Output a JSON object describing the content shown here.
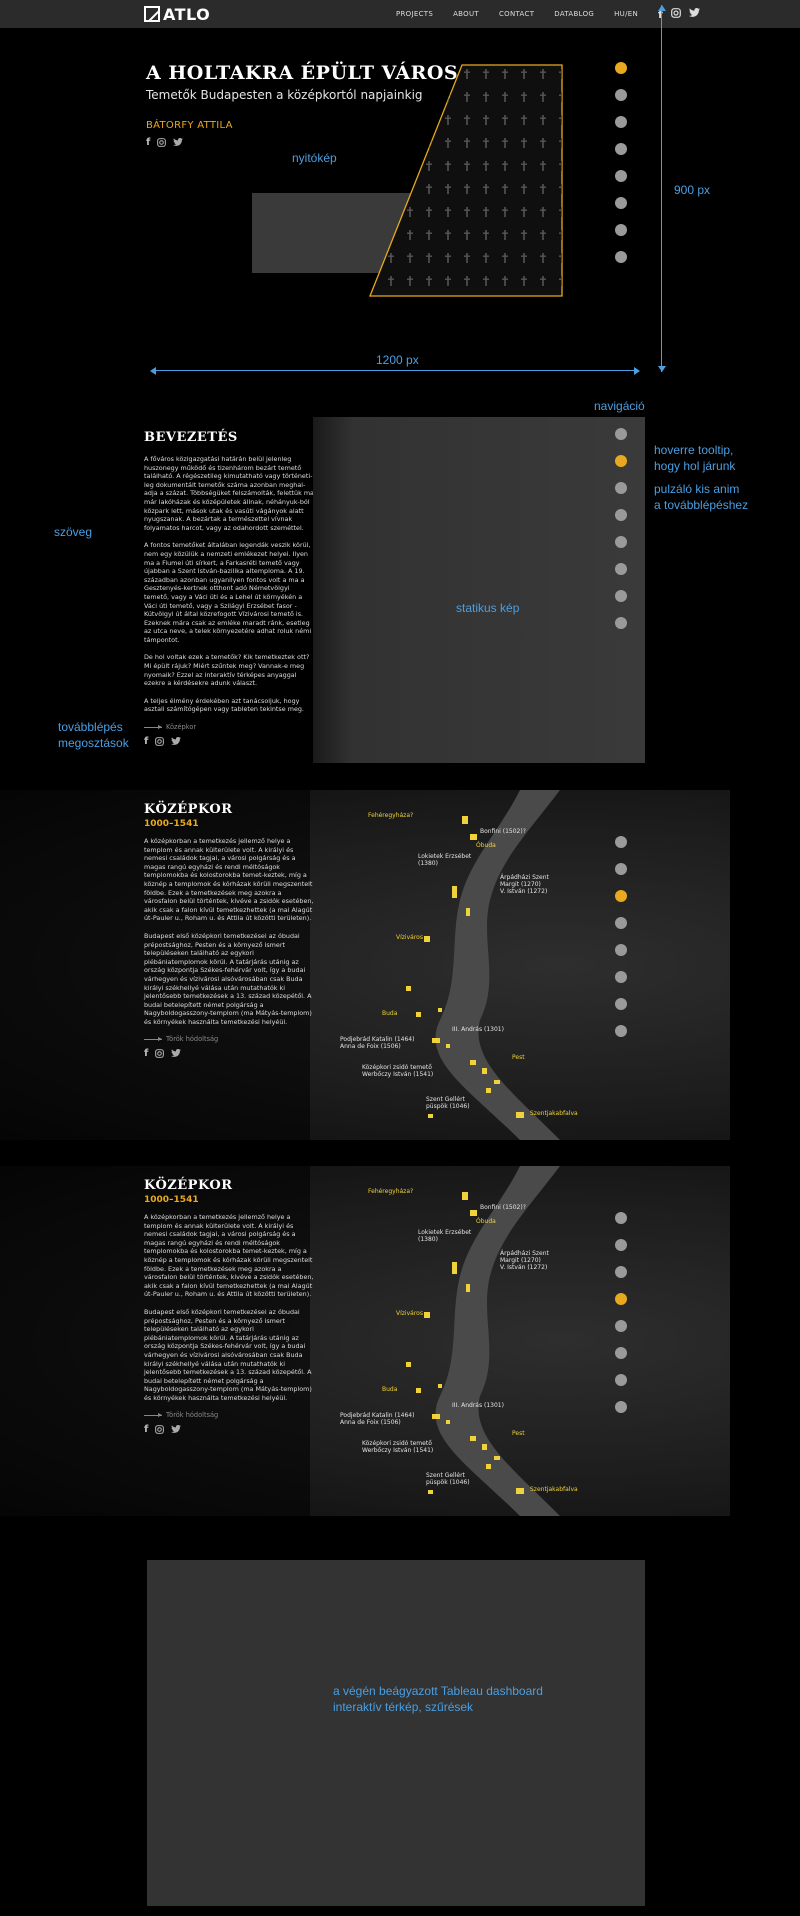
{
  "topbar": {
    "logo_text": "ATLO",
    "nav": [
      "PROJECTS",
      "ABOUT",
      "CONTACT",
      "DATABLOG",
      "HU/EN"
    ]
  },
  "hero": {
    "title": "A HOLTAKRA ÉPÜLT VÁROS",
    "subtitle": "Temetők Budapesten a középkortól napjainkig",
    "author": "BÁTORFY ATTILA",
    "dots_active_index": 0
  },
  "annotations": {
    "nyitokep": "nyitókép",
    "height": "900 px",
    "width": "1200 px",
    "navigacio": "navigáció",
    "tooltip": "hoverre tooltip,\nhogy hol járunk",
    "pulzalo": "pulzáló kis anim\na továbblépéshez",
    "szoveg": "szöveg",
    "statikus": "statikus kép",
    "tovabblepes": "továbblépés\nmegosztások",
    "tableau": "a végén beágyazott Tableau dashboard\ninteraktív térkép, szűrések"
  },
  "intro": {
    "title": "BEVEZETÉS",
    "paragraphs": [
      "A főváros közigazgatási határán belül jelenleg huszonegy működő és tizenhárom bezárt temető található. A régészetileg kimutatható vagy történeti-leg dokumentált temetők száma azonban meghal-adja a százat. Többségüket felszámolták, felettük ma már lakóházak és középületek állnak, néhányuk-ból közpark lett, mások utak és vasúti vágányok alatt nyugszanak. A bezártak a természettel vívnak folyamatos harcot, vagy az odahordott szeméttel.",
      "A fontos temetőket általában legendák veszik körül, nem egy közülük a nemzeti emlékezet helyei. Ilyen ma a Fiumei úti sírkert, a Farkasréti temető vagy újabban a Szent István-bazilika altemploma. A 19. században azonban ugyanilyen fontos volt a ma a Gesztenyés-kertnek otthont adó Németvölgyi temető, vagy a Váci úti és a Lehel út környékén a Váci úti temető, vagy a Szilágyi Erzsébet fasor - Kútvölgyi út által közrefogott Vízivárosi temető is. Ezeknek mára csak az emléke maradt ránk, esetleg az utca neve, a telek környezetére adhat roluk némi támpontot.",
      "De hol voltak ezek a temetők? Kik temetkeztek ott? Mi épült rájuk? Miért szűntek meg? Vannak-e meg nyomaik? Ezzel az interaktív térképes anyaggal ezekre a kérdésekre adunk választ.",
      "A teljes élmény érdekében azt tanácsoljuk, hogy asztali számítógépen vagy tableten tekintse meg."
    ],
    "next": "Középkor",
    "dots_active_index": 1
  },
  "middle_ages": [
    {
      "title": "KÖZÉPKOR",
      "years": "1000–1541",
      "paragraphs": [
        "A középkorban a temetkezés jellemző helye a templom és annak külterülete volt. A királyi és nemesi családok tagjai, a városi polgárság és a magas rangú egyházi és rendi méltóságok templomokba és kolostorokba temet-keztek, míg a köznép a templomok és kórházak körüli megszentelt földbe. Ezek a temetkezések meg azokra a városfalon belül történtek, kivéve a zsidók esetében, akik csak a falon kívül temetkezhettek (a mai Alagút út-Pauler u., Roham u. és Attila út közötti területen).",
        "Budapest első középkori temetkezései az óbudai prépostsághoz, Pesten és a környező ismert településeken található az egykori plébániatemplomok körül. A tatárjárás utánig az ország központja Székes-fehérvár volt, így a budai várhegyen és vízivárosi alsóvárosában csak Buda királyi székhellyé válása után mutathatók ki jelentősebb temetkezések a 13. század közepétől. A budai betelepített német polgárság a Nagyboldogasszony-templom (ma Mátyás-templom) és környékek használta temetkezési helyéül."
      ],
      "next": "Török hódoltság",
      "dots_active_index": 2,
      "map_labels": [
        {
          "text": "Fehéregyháza?",
          "yellow": true
        },
        {
          "text": "Bonfini (1502)?",
          "yellow": false
        },
        {
          "text": "Óbuda",
          "yellow": true
        },
        {
          "text": "Lokietek Erzsébet\n(1380)",
          "yellow": false
        },
        {
          "text": "Árpádházi Szent\nMargit (1270)\nV. István (1272)",
          "yellow": false
        },
        {
          "text": "Víziváros",
          "yellow": true
        },
        {
          "text": "Buda",
          "yellow": true
        },
        {
          "text": "III. András (1301)",
          "yellow": false
        },
        {
          "text": "Podjebrád Katalin (1464)\nAnna de Foix (1506)",
          "yellow": false
        },
        {
          "text": "Pest",
          "yellow": true
        },
        {
          "text": "Középkori zsidó temető\nWerbőczy István (1541)",
          "yellow": false
        },
        {
          "text": "Szent Gellért\npüspök (1046)",
          "yellow": false
        },
        {
          "text": "Szentjakabfalva",
          "yellow": true
        }
      ]
    },
    {
      "title": "KÖZÉPKOR",
      "years": "1000–1541",
      "paragraphs": [
        "A középkorban a temetkezés jellemző helye a templom és annak külterülete volt. A királyi és nemesi családok tagjai, a városi polgárság és a magas rangú egyházi és rendi méltóságok templomokba és kolostorokba temet-keztek, míg a köznép a templomok és kórházak körüli megszentelt földbe. Ezek a temetkezések meg azokra a városfalon belül történtek, kivéve a zsidók esetében, akik csak a falon kívül temetkezhettek (a mai Alagút út-Pauler u., Roham u. és Attila út közötti területen).",
        "Budapest első középkori temetkezései az óbudai prépostsághoz, Pesten és a környező ismert településeken található az egykori plébániatemplomok körül. A tatárjárás utánig az ország központja Székes-fehérvár volt, így a budai várhegyen és vízivárosi alsóvárosában csak Buda királyi székhellyé válása után mutathatók ki jelentősebb temetkezések a 13. század közepétől. A budai betelepített német polgárság a Nagyboldogasszony-templom (ma Mátyás-templom) és környékek használta temetkezési helyéül."
      ],
      "next": "Török hódoltság",
      "dots_active_index": 3,
      "map_labels": [
        {
          "text": "Fehéregyháza?",
          "yellow": true
        },
        {
          "text": "Bonfini (1502)?",
          "yellow": false
        },
        {
          "text": "Óbuda",
          "yellow": true
        },
        {
          "text": "Lokietek Erzsébet\n(1380)",
          "yellow": false
        },
        {
          "text": "Árpádházi Szent\nMargit (1270)\nV. István (1272)",
          "yellow": false
        },
        {
          "text": "Víziváros",
          "yellow": true
        },
        {
          "text": "Buda",
          "yellow": true
        },
        {
          "text": "III. András (1301)",
          "yellow": false
        },
        {
          "text": "Podjebrád Katalin (1464)\nAnna de Foix (1506)",
          "yellow": false
        },
        {
          "text": "Pest",
          "yellow": true
        },
        {
          "text": "Középkori zsidó temető\nWerbőczy István (1541)",
          "yellow": false
        },
        {
          "text": "Szent Gellért\npüspök (1046)",
          "yellow": false
        },
        {
          "text": "Szentjakabfalva",
          "yellow": true
        }
      ]
    }
  ],
  "colors": {
    "accent": "#e8a91e",
    "annotation": "#4a9fe3",
    "dot": "#9a9a9a",
    "topbar": "#2b2b2b",
    "panel": "#333333"
  },
  "icons": [
    "facebook-icon",
    "instagram-icon",
    "twitter-icon",
    "arrow-right-icon",
    "cross-icon",
    "dimension-arrow-icon"
  ]
}
